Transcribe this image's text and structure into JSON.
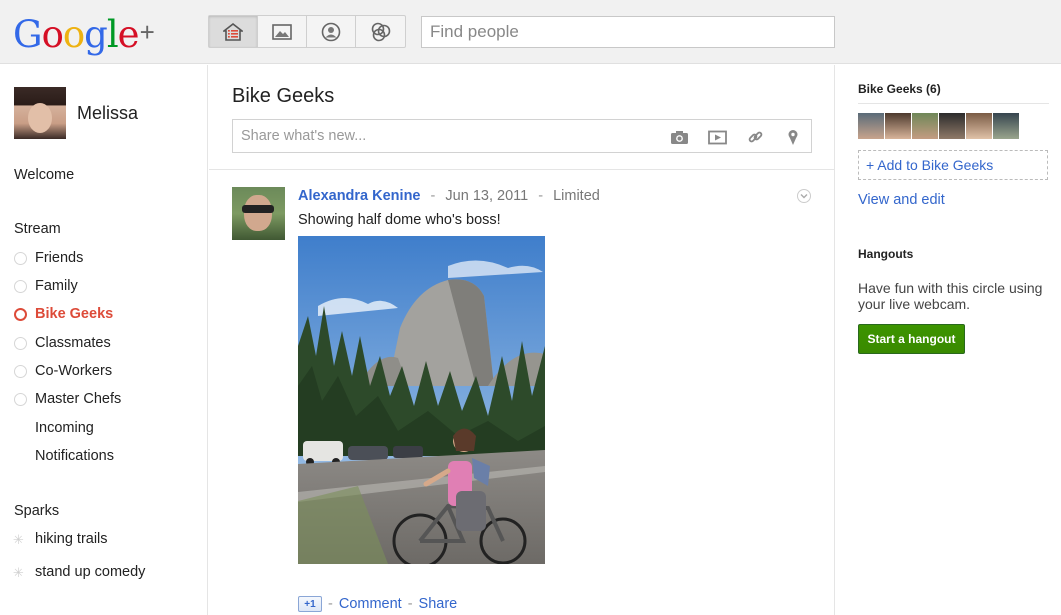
{
  "header": {
    "logo_text": "Google",
    "logo_plus": "+",
    "nav": [
      "home-icon",
      "photos-icon",
      "profile-icon",
      "circles-icon"
    ],
    "search_placeholder": "Find people"
  },
  "sidebar": {
    "user_name": "Melissa",
    "welcome": "Welcome",
    "stream_label": "Stream",
    "circles": [
      {
        "label": "Friends",
        "selected": false
      },
      {
        "label": "Family",
        "selected": false
      },
      {
        "label": "Bike Geeks",
        "selected": true
      },
      {
        "label": "Classmates",
        "selected": false
      },
      {
        "label": "Co-Workers",
        "selected": false
      },
      {
        "label": "Master Chefs",
        "selected": false
      }
    ],
    "incoming": "Incoming",
    "notifications": "Notifications",
    "sparks_label": "Sparks",
    "sparks": [
      "hiking trails",
      "stand up comedy"
    ]
  },
  "main": {
    "title": "Bike Geeks",
    "share_placeholder": "Share what's new...",
    "share_icons": [
      "camera-icon",
      "video-icon",
      "link-icon",
      "location-pin-icon"
    ],
    "post": {
      "author": "Alexandra Kenine",
      "date": "Jun 13, 2011",
      "visibility": "Limited",
      "separator": "-",
      "text": "Showing half dome who's boss!",
      "plus_one": "+1",
      "comment": "Comment",
      "share": "Share"
    }
  },
  "right": {
    "circle_title": "Bike Geeks (6)",
    "add_to_circle": "+ Add to Bike Geeks",
    "view_edit": "View and edit",
    "hangouts_title": "Hangouts",
    "hangouts_text": "Have fun with this circle using your live webcam.",
    "hangout_button": "Start a hangout"
  },
  "colors": {
    "accent_red": "#dd4b39",
    "link_blue": "#3366cc",
    "hangout_green": "#3d9400"
  }
}
